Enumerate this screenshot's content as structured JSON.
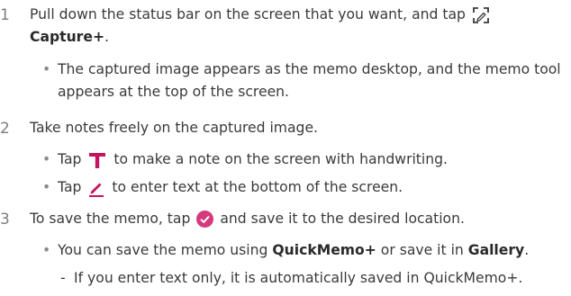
{
  "steps": [
    {
      "number": "1",
      "text_a": "Pull down the status bar on the screen that you want, and tap",
      "icon": "capture-plus-icon",
      "bold": "Capture+",
      "text_b": ".",
      "bullets": [
        {
          "text": "The captured image appears as the memo desktop, and the memo tool appears at the top of the screen."
        }
      ]
    },
    {
      "number": "2",
      "text": "Take notes freely on the captured image.",
      "bullets": [
        {
          "text_a": "Tap",
          "icon": "text-t-icon",
          "text_b": "to make a note on the screen with handwriting."
        },
        {
          "text_a": "Tap",
          "icon": "pen-icon",
          "text_b": "to enter text at the bottom of the screen."
        }
      ]
    },
    {
      "number": "3",
      "text_a": "To save the memo, tap",
      "icon": "check-icon",
      "text_b": "and save it to the desired location.",
      "bullets": [
        {
          "text_a": "You can save the memo using",
          "bold_a": "QuickMemo+",
          "text_b": "or save it in",
          "bold_b": "Gallery",
          "text_c": "."
        }
      ],
      "sub_bullets": [
        {
          "text": "If you enter text only, it is automatically saved in QuickMemo+."
        }
      ]
    }
  ],
  "colors": {
    "accent": "#c3155f",
    "check_bg": "#d43a7c",
    "text": "#3a3a3a"
  }
}
